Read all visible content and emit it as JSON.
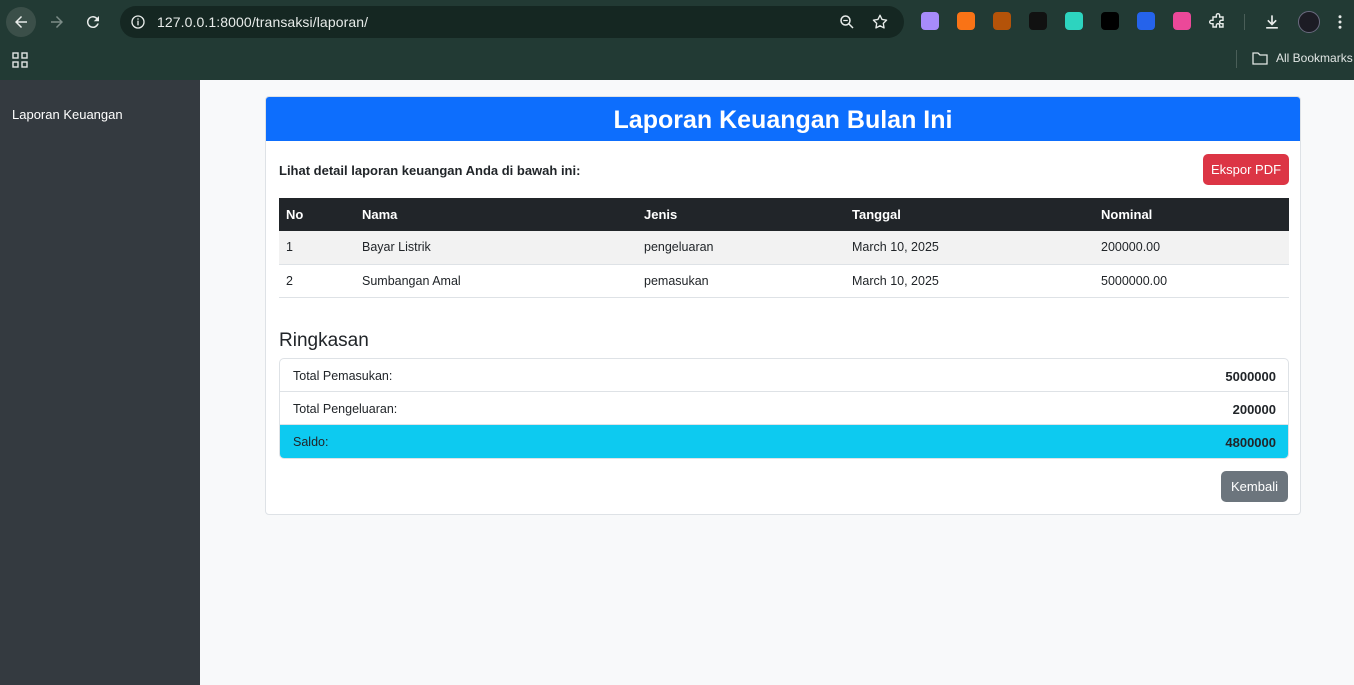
{
  "browser": {
    "url": "127.0.0.1:8000/transaksi/laporan/",
    "bookmarks_label": "All Bookmarks",
    "extensions": [
      {
        "icon": "ghost-extension-icon",
        "color": "#a78bfa",
        "glyph": ""
      },
      {
        "icon": "fox-extension-icon",
        "color": "#f97316",
        "glyph": ""
      },
      {
        "icon": "wave-extension-icon",
        "color": "#b45309",
        "glyph": ""
      },
      {
        "icon": "dots-extension-icon",
        "color": "#111111",
        "glyph": ""
      },
      {
        "icon": "teal-extension-icon",
        "color": "#2dd4bf",
        "glyph": ""
      },
      {
        "icon": "a-extension-icon",
        "color": "#000000",
        "glyph": ""
      },
      {
        "icon": "blue-extension-icon",
        "color": "#2563eb",
        "glyph": ""
      },
      {
        "icon": "pink-extension-icon",
        "color": "#ec4899",
        "glyph": ""
      }
    ]
  },
  "sidebar": {
    "items": [
      {
        "label": "Laporan Keuangan"
      }
    ]
  },
  "report": {
    "title": "Laporan Keuangan Bulan Ini",
    "intro": "Lihat detail laporan keuangan Anda di bawah ini:",
    "export_label": "Ekspor PDF",
    "table": {
      "headers": [
        "No",
        "Nama",
        "Jenis",
        "Tanggal",
        "Nominal"
      ],
      "rows": [
        [
          "1",
          "Bayar Listrik",
          "pengeluaran",
          "March 10, 2025",
          "200000.00"
        ],
        [
          "2",
          "Sumbangan Amal",
          "pemasukan",
          "March 10, 2025",
          "5000000.00"
        ]
      ]
    },
    "summary": {
      "title": "Ringkasan",
      "income_label": "Total Pemasukan:",
      "income_value": "5000000",
      "expense_label": "Total Pengeluaran:",
      "expense_value": "200000",
      "balance_label": "Saldo:",
      "balance_value": "4800000"
    },
    "back_label": "Kembali"
  },
  "colors": {
    "primary": "#0d6efd",
    "danger": "#dc3545",
    "info": "#0dcaf0",
    "secondary": "#6c757d",
    "dark": "#212529",
    "sidebar": "#343a40"
  }
}
